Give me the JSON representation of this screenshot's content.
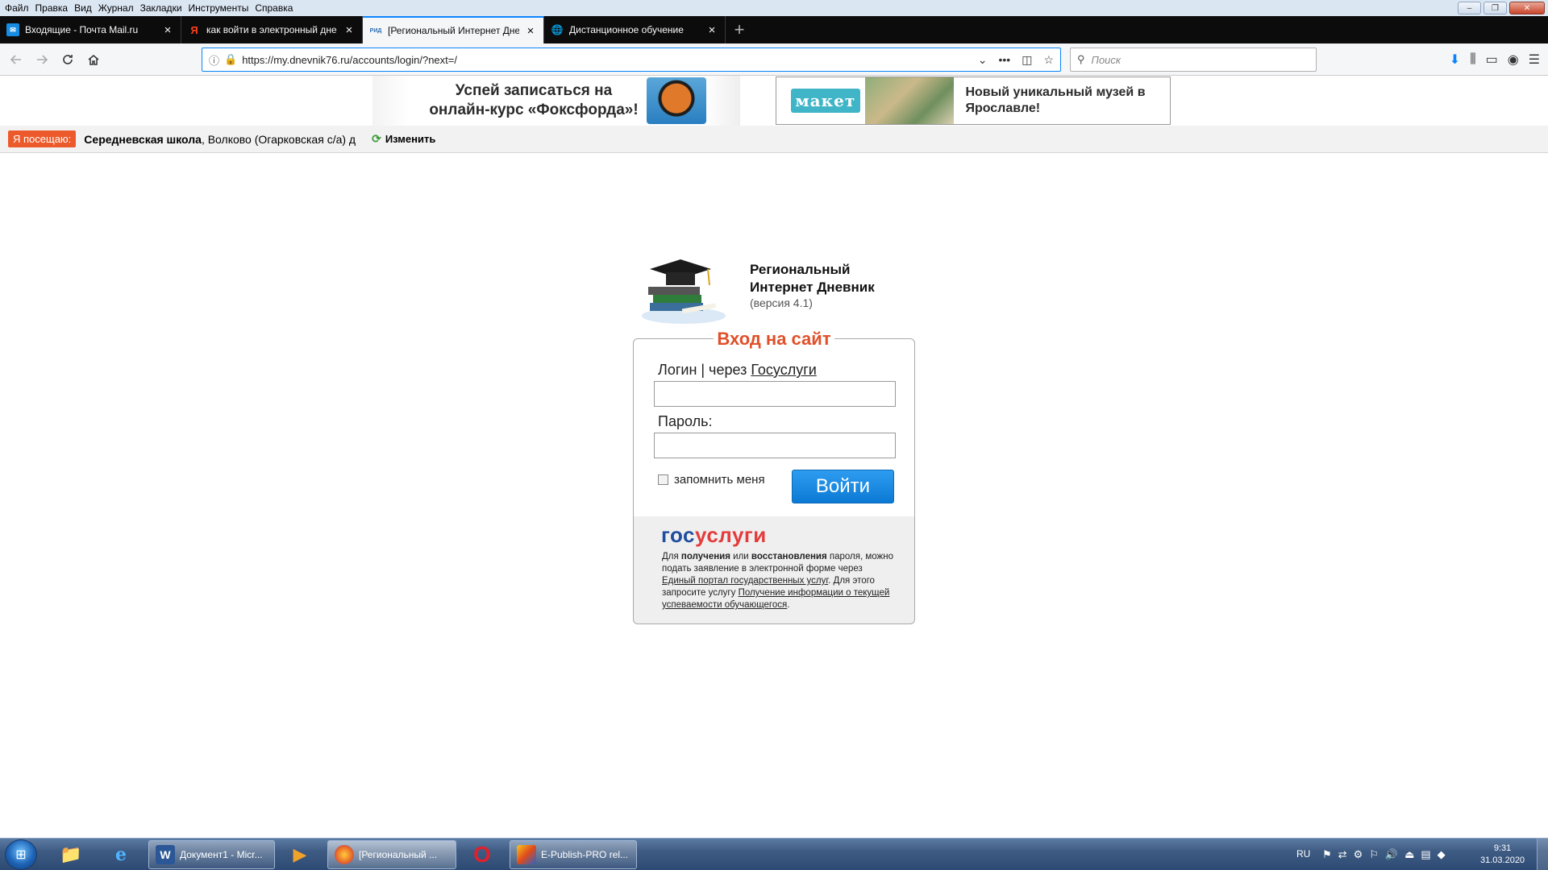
{
  "window": {
    "menu": [
      "Файл",
      "Правка",
      "Вид",
      "Журнал",
      "Закладки",
      "Инструменты",
      "Справка"
    ],
    "controls": {
      "minimize": "–",
      "restore": "❐",
      "close": "✕"
    }
  },
  "tabs": [
    {
      "title": "Входящие - Почта Mail.ru",
      "favicon": "mail-icon",
      "active": false
    },
    {
      "title": "как войти в электронный дне",
      "favicon": "yandex-icon",
      "active": false
    },
    {
      "title": "[Региональный Интернет Дне",
      "favicon": "rid-icon",
      "active": true
    },
    {
      "title": "Дистанционное обучение",
      "favicon": "globe-icon",
      "active": false
    }
  ],
  "tab_favicon_labels": {
    "mail": "✉",
    "yandex": "Я",
    "rid": "РИД",
    "globe": "🌐"
  },
  "newtab_label": "+",
  "navbar": {
    "url": "https://my.dnevnik76.ru/accounts/login/?next=/",
    "search_placeholder": "Поиск"
  },
  "ads": {
    "ad1_text": "Успей записаться на онлайн-курс «Фоксфорда»!",
    "ad2_logo": "макет",
    "ad2_text": "Новый уникальный музей в Ярославле!"
  },
  "visited": {
    "badge": "Я посещаю:",
    "school": "Середневская школа",
    "location": ", Волково (Огарковская с/а) д",
    "change": "Изменить"
  },
  "site": {
    "title_line1": "Региональный",
    "title_line2": "Интернет Дневник",
    "version": "(версия 4.1)"
  },
  "login": {
    "legend": "Вход на сайт",
    "login_label_prefix": "Логин | через ",
    "login_label_link": "Госуслуги",
    "password_label": "Пароль:",
    "remember_label": "запомнить меня",
    "submit": "Войти"
  },
  "gosuslugi": {
    "logo_part1": "гос",
    "logo_part2": "услуги",
    "t1": "Для ",
    "t2": "получения",
    "t3": " или ",
    "t4": "восстановления",
    "t5": " пароля, можно подать заявление в электронной форме через ",
    "t6": "Единый портал государственных услуг",
    "t7": ". Для этого запросите услугу ",
    "t8": "Получение информации о текущей успеваемости обучающегося",
    "t9": "."
  },
  "taskbar": {
    "buttons": [
      {
        "label": "Документ1 - Micr...",
        "icon": "word-icon"
      },
      {
        "label": "[Региональный ...",
        "icon": "firefox-icon"
      },
      {
        "label": "E-Publish-PRO rel...",
        "icon": "epublish-icon"
      }
    ],
    "tray_lang": "RU",
    "time": "9:31",
    "date": "31.03.2020"
  }
}
